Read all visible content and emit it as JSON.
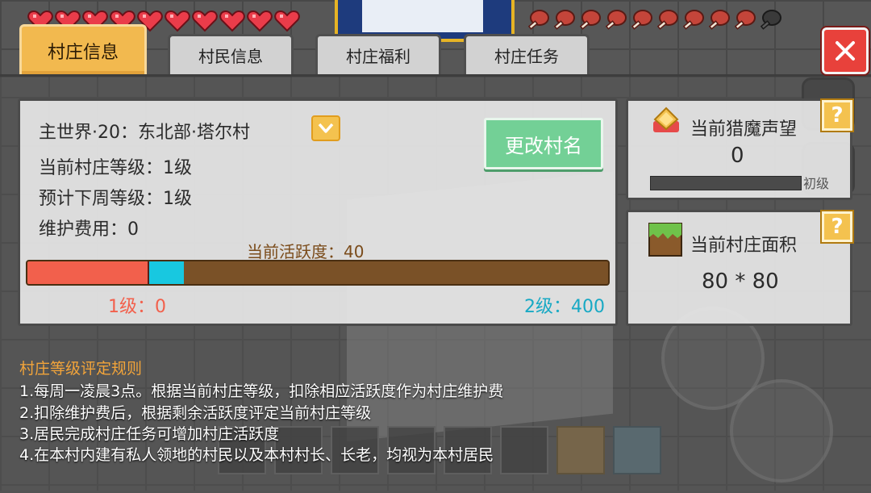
{
  "tabs": [
    {
      "label": "村庄信息",
      "active": true
    },
    {
      "label": "村民信息",
      "active": false
    },
    {
      "label": "村庄福利",
      "active": false
    },
    {
      "label": "村庄任务",
      "active": false
    }
  ],
  "village": {
    "name": "主世界·20：东北部·塔尔村",
    "rename_label": "更改村名",
    "current_level": "当前村庄等级：1级",
    "next_week_level": "预计下周等级：1级",
    "maintenance": "维护费用：0",
    "activity_label": "当前活跃度：40",
    "activity_value": 40,
    "activity_max": 400,
    "activity_deduct": 0,
    "level_left": "1级：0",
    "level_right": "2级：400"
  },
  "reputation": {
    "title": "当前猎魔声望",
    "value": "0",
    "level": "初级",
    "help": "?"
  },
  "area": {
    "title": "当前村庄面积",
    "value": "80 * 80",
    "help": "?"
  },
  "rules": {
    "title": "村庄等级评定规则",
    "items": [
      "1.每周一凌晨3点。根据当前村庄等级，扣除相应活跃度作为村庄维护费",
      "2.扣除维护费后，根据剩余活跃度评定当前村庄等级",
      "3.居民完成村庄任务可增加村庄活跃度",
      "4.在本村内建有私人领地的村民以及本村村长、长老，均视为本村居民"
    ]
  },
  "hud": {
    "hearts": 10,
    "hunger_full": 9,
    "hunger_empty": 1
  },
  "colors": {
    "tab_active": "#f2b94f",
    "rename_button": "#73d096",
    "activity_fill": "#f2604c",
    "activity_cyan": "#18c8e0",
    "close_button": "#e8413b",
    "rules_title": "#f2a43a"
  },
  "icons": {
    "close": "close-icon",
    "dropdown": "chevron-down-icon",
    "reputation": "crown-gem-icon",
    "area": "grass-block-icon",
    "help": "question-icon"
  }
}
